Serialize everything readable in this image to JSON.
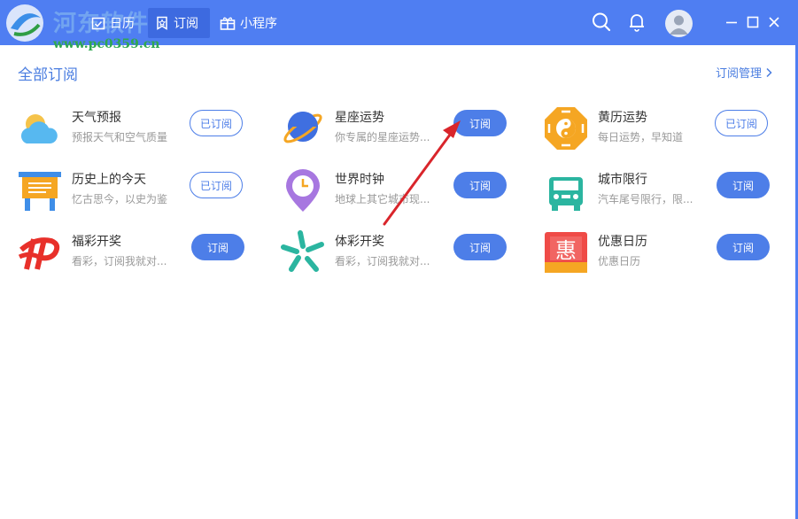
{
  "watermark": {
    "text": "河东软件网",
    "url": "www.pc0359.cn"
  },
  "nav": {
    "tabs": [
      {
        "label": "日历"
      },
      {
        "label": "订阅"
      },
      {
        "label": "小程序"
      }
    ]
  },
  "section": {
    "title": "全部订阅",
    "manage_label": "订阅管理"
  },
  "items": [
    {
      "name": "天气预报",
      "desc": "预报天气和空气质量",
      "button": "已订阅"
    },
    {
      "name": "星座运势",
      "desc": "你专属的星座运势...",
      "button": "订阅"
    },
    {
      "name": "黄历运势",
      "desc": "每日运势，早知道",
      "button": "已订阅"
    },
    {
      "name": "历史上的今天",
      "desc": "忆古思今，以史为鉴",
      "button": "已订阅"
    },
    {
      "name": "世界时钟",
      "desc": "地球上其它城市现...",
      "button": "订阅"
    },
    {
      "name": "城市限行",
      "desc": "汽车尾号限行，限...",
      "button": "订阅"
    },
    {
      "name": "福彩开奖",
      "desc": "看彩，订阅我就对...",
      "button": "订阅"
    },
    {
      "name": "体彩开奖",
      "desc": "看彩，订阅我就对...",
      "button": "订阅"
    },
    {
      "name": "优惠日历",
      "desc": "优惠日历",
      "button": "订阅"
    }
  ],
  "colors": {
    "header": "#4f7ef2",
    "accent": "#4d7ee8",
    "arrow": "#d9252b"
  }
}
